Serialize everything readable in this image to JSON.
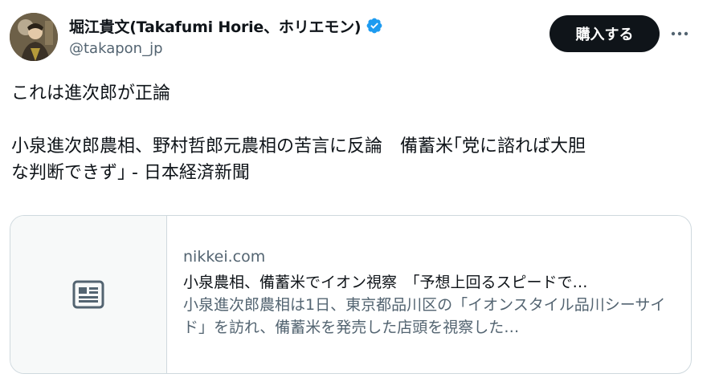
{
  "author": {
    "name": "堀江貴文(Takafumi Horie、ホリエモン)",
    "handle": "@takapon_jp",
    "verified_color": "#1d9bf0"
  },
  "actions": {
    "subscribe_label": "購入する",
    "more_icon": "more-horizontal-icon"
  },
  "tweet": {
    "line1": "これは進次郎が正論",
    "line2": "小泉進次郎農相、野村哲郎元農相の苦言に反論　備蓄米｢党に諮れば大胆",
    "line3": "な判断できず｣ - 日本経済新聞"
  },
  "card": {
    "domain": "nikkei.com",
    "title": "小泉農相、備蓄米でイオン視察　「予想上回るスピードで…",
    "description": "小泉進次郎農相は1日、東京都品川区の「イオンスタイル品川シーサイド」を訪れ、備蓄米を発売した店頭を視察した…",
    "thumb_icon": "article-icon"
  },
  "colors": {
    "text_primary": "#0f1419",
    "text_secondary": "#536471",
    "border": "#cfd9de",
    "button_bg": "#0f1419"
  }
}
